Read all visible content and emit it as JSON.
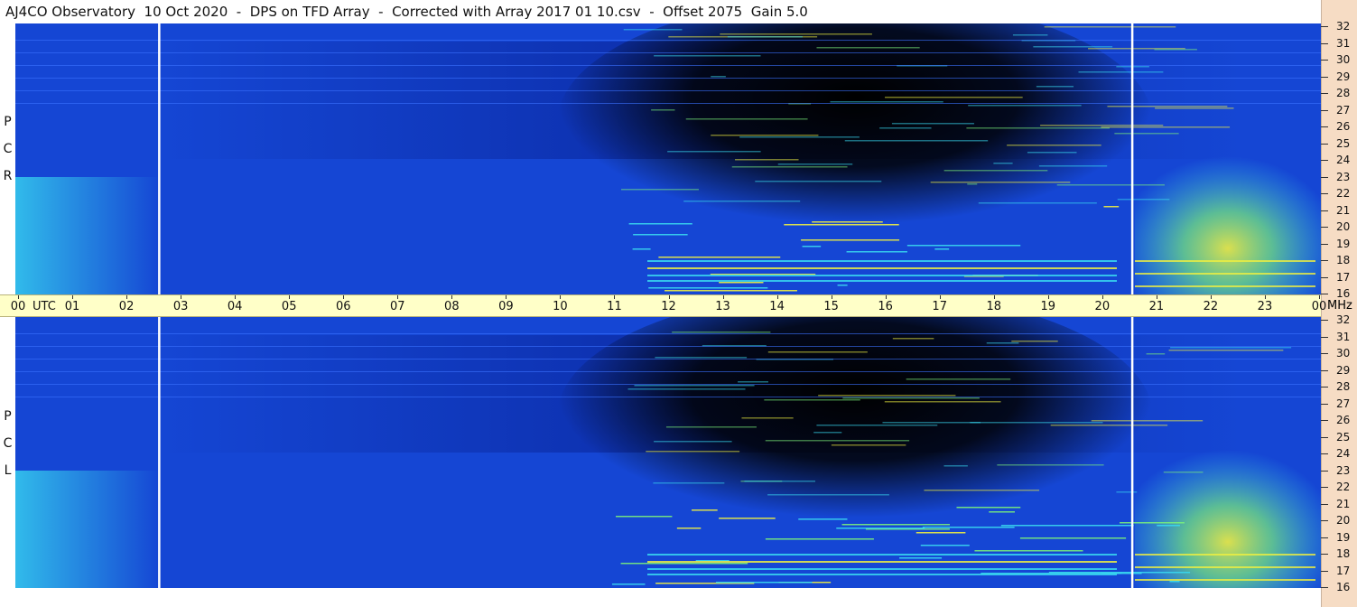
{
  "title": "AJ4CO Observatory  10 Oct 2020  -  DPS on TFD Array  -  Corrected with Array 2017 01 10.csv  -  Offset 2075  Gain 5.0",
  "colors": {
    "background_blue": "#1546d4",
    "deep_blue": "#0a28a0",
    "black": "#000000",
    "cyan": "#38d8f0",
    "green": "#7af07a",
    "yellow": "#f0f040",
    "axis_band": "#ffffc8",
    "right_strip": "#f6dcc4",
    "marker_white": "#ffffff"
  },
  "chart_data": [
    {
      "type": "heatmap",
      "panel": "upper",
      "side_label": [
        "R",
        "C",
        "P"
      ],
      "x_unit": "UTC",
      "y_unit": "MHz",
      "x_ticks": [
        "00",
        "01",
        "02",
        "03",
        "04",
        "05",
        "06",
        "07",
        "08",
        "09",
        "10",
        "11",
        "12",
        "13",
        "14",
        "15",
        "16",
        "17",
        "18",
        "19",
        "20",
        "21",
        "22",
        "23",
        "00"
      ],
      "y_ticks": [
        "32",
        "31",
        "30",
        "29",
        "28",
        "27",
        "26",
        "25",
        "24",
        "23",
        "22",
        "21",
        "20",
        "19",
        "18",
        "17",
        "16"
      ],
      "xlim": [
        0,
        24
      ],
      "ylim": [
        16,
        32
      ],
      "marker_lines_utc": [
        2.6,
        20.55
      ]
    },
    {
      "type": "heatmap",
      "panel": "lower",
      "side_label": [
        "L",
        "C",
        "P"
      ],
      "x_unit": "UTC",
      "y_unit": "MHz",
      "x_ticks": [
        "00",
        "01",
        "02",
        "03",
        "04",
        "05",
        "06",
        "07",
        "08",
        "09",
        "10",
        "11",
        "12",
        "13",
        "14",
        "15",
        "16",
        "17",
        "18",
        "19",
        "20",
        "21",
        "22",
        "23",
        "00"
      ],
      "y_ticks": [
        "32",
        "31",
        "30",
        "29",
        "28",
        "27",
        "26",
        "25",
        "24",
        "23",
        "22",
        "21",
        "20",
        "19",
        "18",
        "17",
        "16"
      ],
      "xlim": [
        0,
        24
      ],
      "ylim": [
        16,
        32
      ],
      "marker_lines_utc": [
        2.6,
        20.55
      ]
    }
  ]
}
